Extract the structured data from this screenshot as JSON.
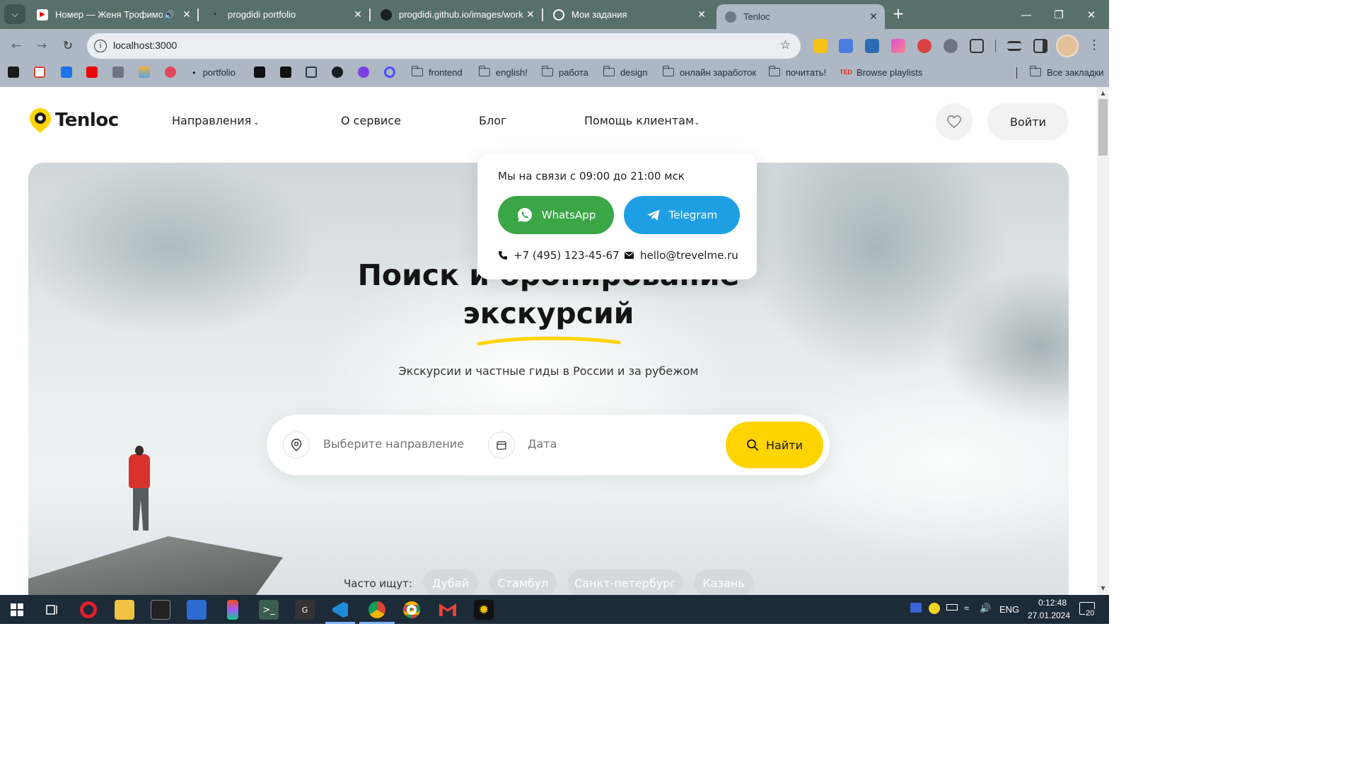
{
  "browser": {
    "tabs": [
      {
        "title": "Номер — Женя Трофимов",
        "icon": "youtube-icon",
        "audio": true
      },
      {
        "title": "progdidi portfolio",
        "icon": "page-icon"
      },
      {
        "title": "progdidi.github.io/images/work",
        "icon": "github-icon"
      },
      {
        "title": "Мои задания",
        "icon": "tasks-icon"
      },
      {
        "title": "Tenloc",
        "icon": "globe-icon",
        "active": true
      }
    ],
    "url": "localhost:3000",
    "bookmarks": [
      {
        "label": "portfolio"
      },
      {
        "label": "frontend"
      },
      {
        "label": "english!"
      },
      {
        "label": "работа"
      },
      {
        "label": "design"
      },
      {
        "label": "онлайн заработок"
      },
      {
        "label": "почитать!"
      },
      {
        "label": "Browse playlists"
      }
    ],
    "all_bookmarks": "Все закладки"
  },
  "site": {
    "logo": "Tenloc",
    "nav": {
      "directions": "Направления",
      "about": "О сервисе",
      "blog": "Блог",
      "help": "Помощь клиентам"
    },
    "login": "Войти",
    "help_popover": {
      "hours": "Мы на связи с 09:00 до 21:00 мск",
      "whatsapp": "WhatsApp",
      "telegram": "Telegram",
      "phone": "+7 (495) 123-45-67",
      "email": "hello@trevelme.ru"
    },
    "hero": {
      "title_line1": "Поиск и бронирование",
      "title_line2": "экскурсий",
      "subtitle": "Экскурсии и частные гиды в России и за рубежом"
    },
    "search": {
      "direction_placeholder": "Выберите направление",
      "date_placeholder": "Дата",
      "find_label": "Найти"
    },
    "popular": {
      "label": "Часто ищут:",
      "items": [
        "Дубай",
        "Стамбул",
        "Санкт-петербург",
        "Казань"
      ]
    }
  },
  "taskbar": {
    "language": "ENG",
    "time": "0:12:48",
    "date": "27.01.2024",
    "notifications": "20"
  },
  "colors": {
    "accent_yellow": "#ffd400",
    "whatsapp_green": "#3aa645",
    "telegram_blue": "#1e9fe3",
    "tabstrip": "#57706a",
    "toolbar": "#aeb8c4"
  }
}
